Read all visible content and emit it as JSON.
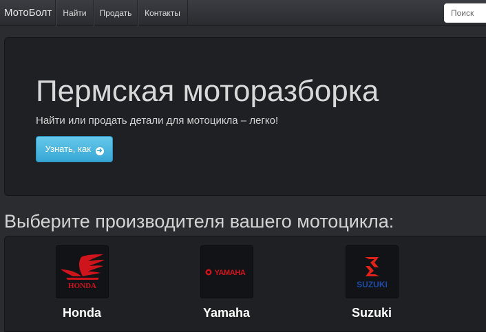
{
  "navbar": {
    "brand": "МотоБолт",
    "items": [
      {
        "label": "Найти"
      },
      {
        "label": "Продать"
      },
      {
        "label": "Контакты"
      }
    ],
    "search_placeholder": "Поиск"
  },
  "hero": {
    "title": "Пермская моторазборка",
    "subtitle": "Найти или продать детали для мотоцикла – легко!",
    "button_label": "Узнать, как",
    "button_icon": "arrow-circle-right-icon"
  },
  "manufacturers": {
    "heading": "Выберите производителя вашего мотоцикла:",
    "items": [
      {
        "name": "Honda",
        "logo_text": "HONDA"
      },
      {
        "name": "Yamaha",
        "logo_text": "YAMAHA"
      },
      {
        "name": "Suzuki",
        "logo_text": "SUZUKI"
      }
    ]
  },
  "colors": {
    "accent": "#39a8d8",
    "honda_red": "#d0141c",
    "yamaha_red": "#d0141c",
    "suzuki_red": "#e2231a",
    "suzuki_blue": "#1f4aa8"
  }
}
